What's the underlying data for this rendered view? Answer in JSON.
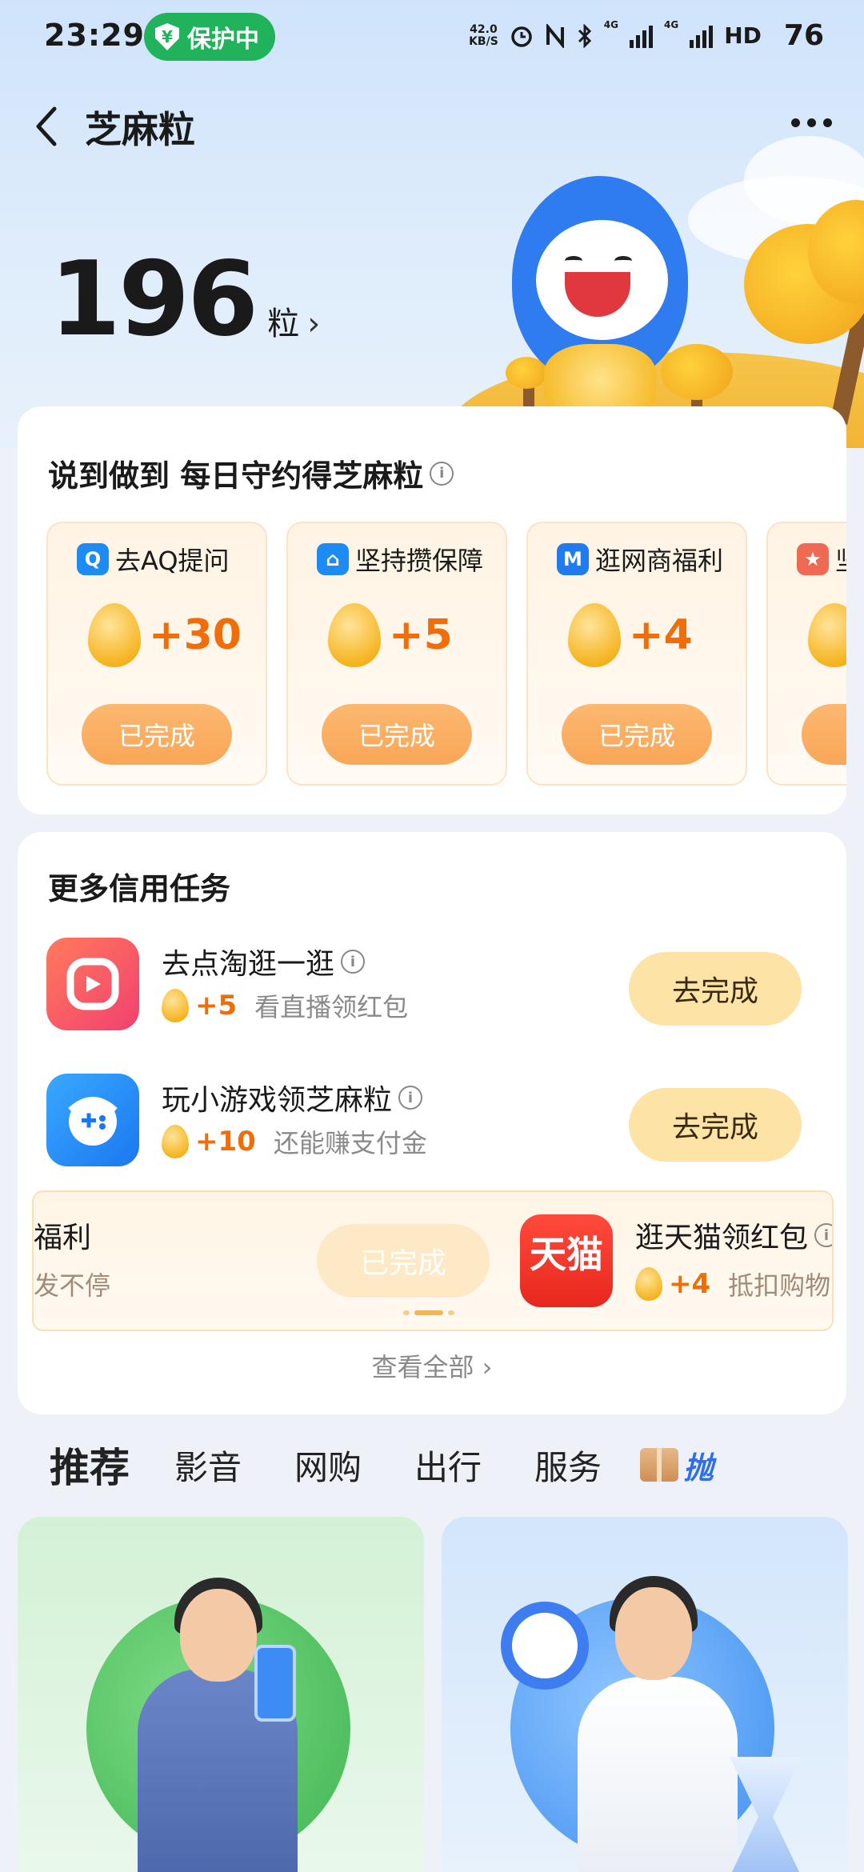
{
  "status_bar": {
    "time": "23:29",
    "protect_label": "保护中",
    "net_speed_value": "42.0",
    "net_speed_unit": "KB/S",
    "network_4g_1": "4G",
    "network_4g_2": "4G",
    "hd_label": "HD",
    "battery": "76"
  },
  "header": {
    "title": "芝麻粒",
    "points_value": "196",
    "points_unit": "粒",
    "points_arrow": "›"
  },
  "daily": {
    "title": "说到做到 每日守约得芝麻粒",
    "info_glyph": "i",
    "items": [
      {
        "label": "去AQ提问",
        "badge_glyph": "Q",
        "badge_color": "#1e8bf5",
        "amount": "+30",
        "status": "已完成"
      },
      {
        "label": "坚持攒保障",
        "badge_glyph": "⌂",
        "badge_color": "#1e8bf5",
        "amount": "+5",
        "status": "已完成"
      },
      {
        "label": "逛网商福利",
        "badge_glyph": "M",
        "badge_color": "#1e7cf0",
        "amount": "+4",
        "status": "已完成"
      },
      {
        "label": "坚",
        "badge_glyph": "★",
        "badge_color": "#f06a53",
        "amount": "",
        "status": "已"
      }
    ]
  },
  "more_tasks": {
    "title": "更多信用任务",
    "tasks": [
      {
        "name": "去点淘逛一逛",
        "amount": "+5",
        "desc": "看直播领红包",
        "button": "去完成",
        "icon": "diantao-icon",
        "icon_color": "#f5536b"
      },
      {
        "name": "玩小游戏领芝麻粒",
        "amount": "+10",
        "desc": "还能赚支付金",
        "button": "去完成",
        "icon": "game-controller-icon",
        "icon_color": "#1e8bf5"
      }
    ],
    "carousel": {
      "partial_name": "福利",
      "partial_desc": "发不停",
      "partial_button": "已完成",
      "tmall_icon_text": "天猫",
      "tmall_name": "逛天猫领红包",
      "tmall_amount": "+4",
      "tmall_desc": "抵扣购物费"
    },
    "view_all": "查看全部 ›"
  },
  "tabs": {
    "items": [
      "推荐",
      "影音",
      "网购",
      "出行",
      "服务"
    ],
    "active_index": 0,
    "promo_glyph": "抛"
  },
  "colors": {
    "accent_orange": "#f06d0a",
    "done_button": "#f9a657",
    "go_button": "#fde3a6",
    "protect_green": "#21b35b"
  }
}
